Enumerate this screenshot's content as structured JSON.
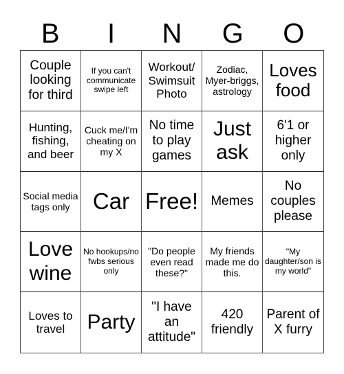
{
  "header": {
    "letters": [
      "B",
      "I",
      "N",
      "G",
      "O"
    ]
  },
  "cells": [
    {
      "text": "Couple looking for third",
      "size": "s-l"
    },
    {
      "text": "If you can't communicate swipe left",
      "size": "s-xs"
    },
    {
      "text": "Workout/ Swimsuit Photo",
      "size": "s-m"
    },
    {
      "text": "Zodiac, Myer-briggs, astrology",
      "size": "s-s"
    },
    {
      "text": "Loves food",
      "size": "s-xl"
    },
    {
      "text": "Hunting, fishing, and beer",
      "size": "s-m"
    },
    {
      "text": "Cuck me/I'm cheating on my X",
      "size": "s-s"
    },
    {
      "text": "No time to play games",
      "size": "s-l"
    },
    {
      "text": "Just ask",
      "size": "s-xxl"
    },
    {
      "text": "6'1 or higher only",
      "size": "s-l"
    },
    {
      "text": "Social media tags only",
      "size": "s-s"
    },
    {
      "text": "Car",
      "size": "s-huge"
    },
    {
      "text": "Free!",
      "size": "s-huge"
    },
    {
      "text": "Memes",
      "size": "s-l"
    },
    {
      "text": "No couples please",
      "size": "s-l"
    },
    {
      "text": "Love wine",
      "size": "s-xxl"
    },
    {
      "text": "No hookups/no fwbs serious only",
      "size": "s-xs"
    },
    {
      "text": "\"Do people even read these?\"",
      "size": "s-s"
    },
    {
      "text": "My friends made me do this.",
      "size": "s-s"
    },
    {
      "text": "\"My daughter/son is my world\"",
      "size": "s-xs"
    },
    {
      "text": "Loves to travel",
      "size": "s-m"
    },
    {
      "text": "Party",
      "size": "s-xxl"
    },
    {
      "text": "\"I have an attitude\"",
      "size": "s-l"
    },
    {
      "text": "420 friendly",
      "size": "s-l"
    },
    {
      "text": "Parent of X furry",
      "size": "s-l"
    }
  ]
}
